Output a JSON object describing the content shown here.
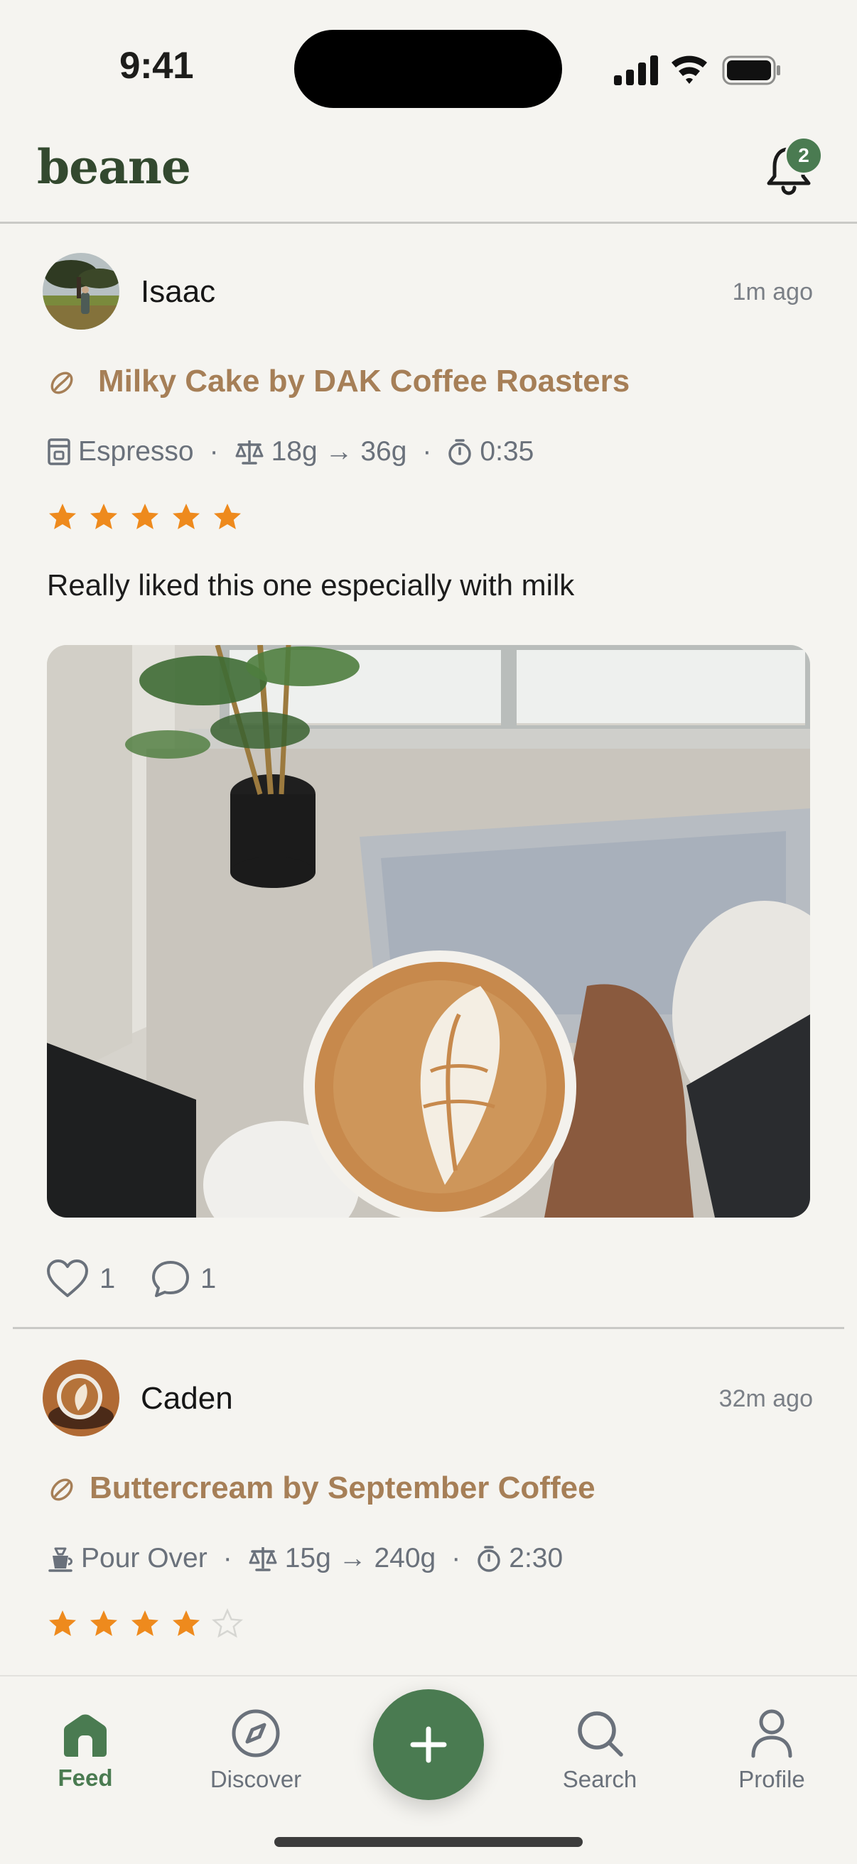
{
  "status_bar": {
    "time": "9:41"
  },
  "header": {
    "app_name": "beane",
    "notification_count": "2"
  },
  "posts": [
    {
      "user": "Isaac",
      "time_ago": "1m ago",
      "coffee": "Milky Cake by DAK Coffee Roasters",
      "method": "Espresso",
      "ratio": "18g → 36g",
      "brew_time": "0:35",
      "rating": 5,
      "rating_max": 5,
      "note": "Really liked this one especially with milk",
      "likes": "1",
      "comments": "1"
    },
    {
      "user": "Caden",
      "time_ago": "32m ago",
      "coffee": "Buttercream by September Coffee",
      "method": "Pour Over",
      "ratio": "15g → 240g",
      "brew_time": "2:30",
      "rating": 4,
      "rating_max": 5
    }
  ],
  "tabs": {
    "feed": "Feed",
    "discover": "Discover",
    "search": "Search",
    "profile": "Profile"
  },
  "colors": {
    "brand_green": "#4A7B51",
    "logo_green": "#33492F",
    "coffee_title": "#A67F57",
    "star": "#EE8A1D",
    "background": "#F5F4F0"
  },
  "icons": [
    "signal-icon",
    "wifi-icon",
    "battery-icon",
    "bell-icon",
    "bean-icon",
    "espresso-machine-icon",
    "scale-icon",
    "timer-icon",
    "star-icon",
    "heart-icon",
    "comment-icon",
    "pour-over-icon",
    "home-icon",
    "compass-icon",
    "plus-icon",
    "search-icon",
    "profile-icon"
  ]
}
